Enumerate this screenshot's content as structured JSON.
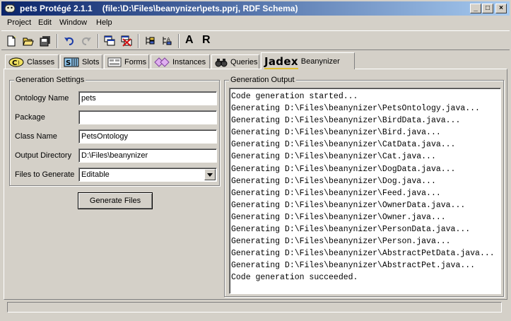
{
  "window": {
    "app_name": "pets",
    "app_version": "Protégé 2.1.1",
    "document": "(file:\\D:\\Files\\beanynizer\\pets.pprj, RDF Schema)",
    "minimize": "_",
    "maximize": "□",
    "close": "×"
  },
  "menu": [
    "Project",
    "Edit",
    "Window",
    "Help"
  ],
  "toolbar": {
    "letter_a": "A",
    "letter_r": "R"
  },
  "tabs": [
    {
      "label": "Classes",
      "icon": "classes-icon"
    },
    {
      "label": "Slots",
      "icon": "slots-icon"
    },
    {
      "label": "Forms",
      "icon": "forms-icon"
    },
    {
      "label": "Instances",
      "icon": "instances-icon"
    },
    {
      "label": "Queries",
      "icon": "queries-icon"
    },
    {
      "label": "Beanynizer",
      "logo": "Jadex",
      "active": true
    }
  ],
  "settings": {
    "title": "Generation Settings",
    "fields": [
      {
        "label": "Ontology Name",
        "value": "pets"
      },
      {
        "label": "Package",
        "value": ""
      },
      {
        "label": "Class Name",
        "value": "PetsOntology"
      },
      {
        "label": "Output Directory",
        "value": "D:\\Files\\beanynizer"
      }
    ],
    "files_label": "Files to Generate",
    "files_value": "Editable",
    "generate_button": "Generate Files"
  },
  "output": {
    "title": "Generation Output",
    "lines": [
      "Code generation started...",
      "Generating D:\\Files\\beanynizer\\PetsOntology.java...",
      "Generating D:\\Files\\beanynizer\\BirdData.java...",
      "Generating D:\\Files\\beanynizer\\Bird.java...",
      "Generating D:\\Files\\beanynizer\\CatData.java...",
      "Generating D:\\Files\\beanynizer\\Cat.java...",
      "Generating D:\\Files\\beanynizer\\DogData.java...",
      "Generating D:\\Files\\beanynizer\\Dog.java...",
      "Generating D:\\Files\\beanynizer\\Feed.java...",
      "Generating D:\\Files\\beanynizer\\OwnerData.java...",
      "Generating D:\\Files\\beanynizer\\Owner.java...",
      "Generating D:\\Files\\beanynizer\\PersonData.java...",
      "Generating D:\\Files\\beanynizer\\Person.java...",
      "Generating D:\\Files\\beanynizer\\AbstractPetData.java...",
      "Generating D:\\Files\\beanynizer\\AbstractPet.java...",
      "Code generation succeeded."
    ]
  },
  "colors": {
    "title_start": "#0a246a",
    "title_end": "#a6caf0",
    "face": "#d4d0c8"
  }
}
